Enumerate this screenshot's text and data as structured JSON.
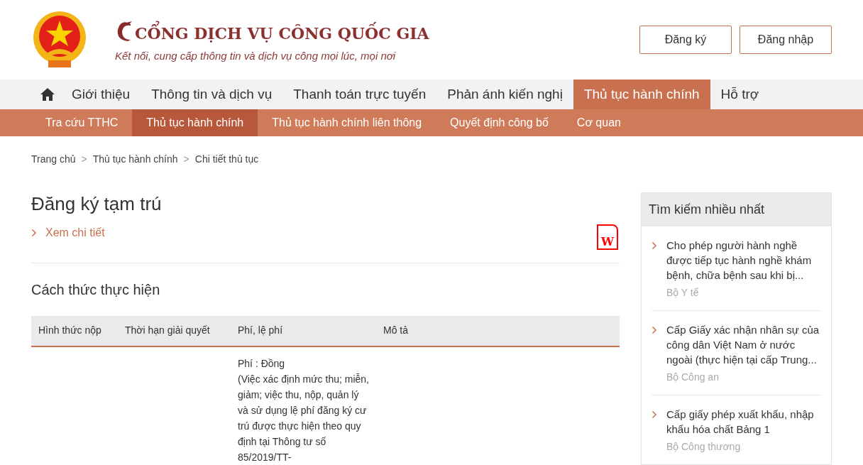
{
  "header": {
    "title": "CỔNG DỊCH VỤ CÔNG QUỐC GIA",
    "slogan": "Kết nối, cung cấp thông tin và dịch vụ công mọi lúc, mọi nơi",
    "buttons": [
      "Đăng ký",
      "Đăng nhập"
    ]
  },
  "main_nav": [
    {
      "label": "Giới thiệu",
      "selected": false
    },
    {
      "label": "Thông tin và dịch vụ",
      "selected": false
    },
    {
      "label": "Thanh toán trực tuyến",
      "selected": false
    },
    {
      "label": "Phản ánh kiến nghị",
      "selected": false
    },
    {
      "label": "Thủ tục hành chính",
      "selected": true
    },
    {
      "label": "Hỗ trợ",
      "selected": false
    }
  ],
  "sub_nav": [
    {
      "label": "Tra cứu TTHC",
      "selected": false
    },
    {
      "label": "Thủ tục hành chính",
      "selected": true
    },
    {
      "label": "Thủ tục hành chính liên thông",
      "selected": false
    },
    {
      "label": "Quyết định công bố",
      "selected": false
    },
    {
      "label": "Cơ quan",
      "selected": false
    }
  ],
  "breadcrumb": [
    {
      "label": "Trang chủ"
    },
    {
      "label": "Thủ tục hành chính"
    },
    {
      "label": "Chi tiết thủ tục"
    }
  ],
  "breadcrumb_separator": ">",
  "procedure": {
    "title": "Đăng ký tạm trú",
    "details_link": "Xem chi tiết",
    "word_icon_letter": "W"
  },
  "section": {
    "title": "Cách thức thực hiện",
    "table": {
      "columns": [
        "Hình thức nộp",
        "Thời hạn giải quyết",
        "Phí, lệ phí",
        "Mô tả"
      ],
      "rows": [
        {
          "fee": "Phí : Đồng",
          "fee_note": "(Việc xác định mức thu; miễn, giảm; việc thu, nộp, quản lý và sử dụng lệ phí đăng ký cư trú được thực hiện theo quy định tại Thông tư số 85/2019/TT-"
        }
      ]
    }
  },
  "sidebar": {
    "title": "Tìm kiếm nhiều nhất",
    "items": [
      {
        "title": "Cho phép người hành nghề được tiếp tục hành nghề khám bệnh, chữa bệnh sau khi bị...",
        "agency": "Bộ Y tế"
      },
      {
        "title": "Cấp Giấy xác nhận nhân sự của công dân Việt Nam ở nước ngoài (thực hiện tại cấp Trung...",
        "agency": "Bộ Công an"
      },
      {
        "title": "Cấp giấy phép xuất khẩu, nhập khẩu hóa chất Bảng 1",
        "agency": "Bộ Công thương"
      }
    ]
  }
}
